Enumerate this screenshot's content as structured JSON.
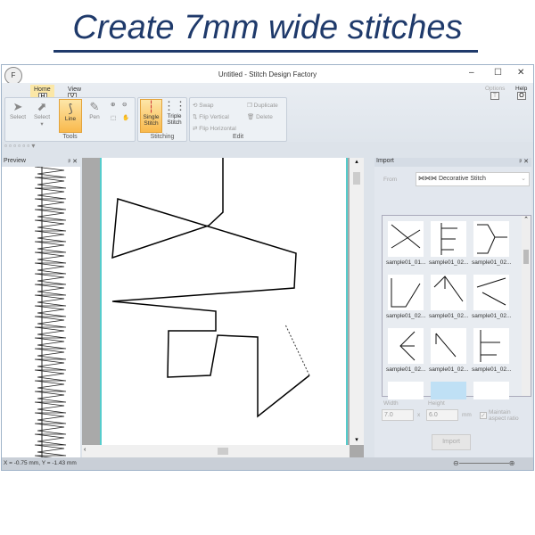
{
  "headline": "Create 7mm wide stitches",
  "window": {
    "title": "Untitled - Stitch Design Factory",
    "app_icon": "F",
    "options": "Options",
    "help": "Help",
    "options_key": "T",
    "help_key": "O"
  },
  "tabs": [
    {
      "label": "Home",
      "key": "H",
      "active": true
    },
    {
      "label": "View",
      "key": "V",
      "active": false
    }
  ],
  "ribbon": {
    "tools": {
      "label": "Tools",
      "buttons": [
        "Select",
        "Select",
        "Line",
        "Pen"
      ]
    },
    "stitching": {
      "label": "Stitching",
      "single": "Single Stitch",
      "triple": "Triple Stitch"
    },
    "edit": {
      "label": "Edit",
      "swap": "Swap",
      "flip_vertical": "Flip Vertical",
      "flip_horizontal": "Flip Horizontal",
      "duplicate": "Duplicate",
      "delete": "Delete"
    }
  },
  "preview": {
    "title": "Preview"
  },
  "import": {
    "title": "Import",
    "from_label": "From",
    "from_value": "Decorative Stitch",
    "thumbs": [
      "sample01_01...",
      "sample01_02...",
      "sample01_02...",
      "sample01_02...",
      "sample01_02...",
      "sample01_02...",
      "sample01_02...",
      "sample01_02...",
      "sample01_02..."
    ],
    "width_label": "Width",
    "width_value": "7.0",
    "height_label": "Height",
    "height_value": "6.0",
    "unit": "mm",
    "times": "x",
    "maintain": "Maintain aspect ratio",
    "import_button": "Import"
  },
  "status": {
    "coords": "X = -0.75 mm, Y = -1.43 mm"
  },
  "colors": {
    "accent": "#f9b94c",
    "headline": "#1f3a6b"
  }
}
